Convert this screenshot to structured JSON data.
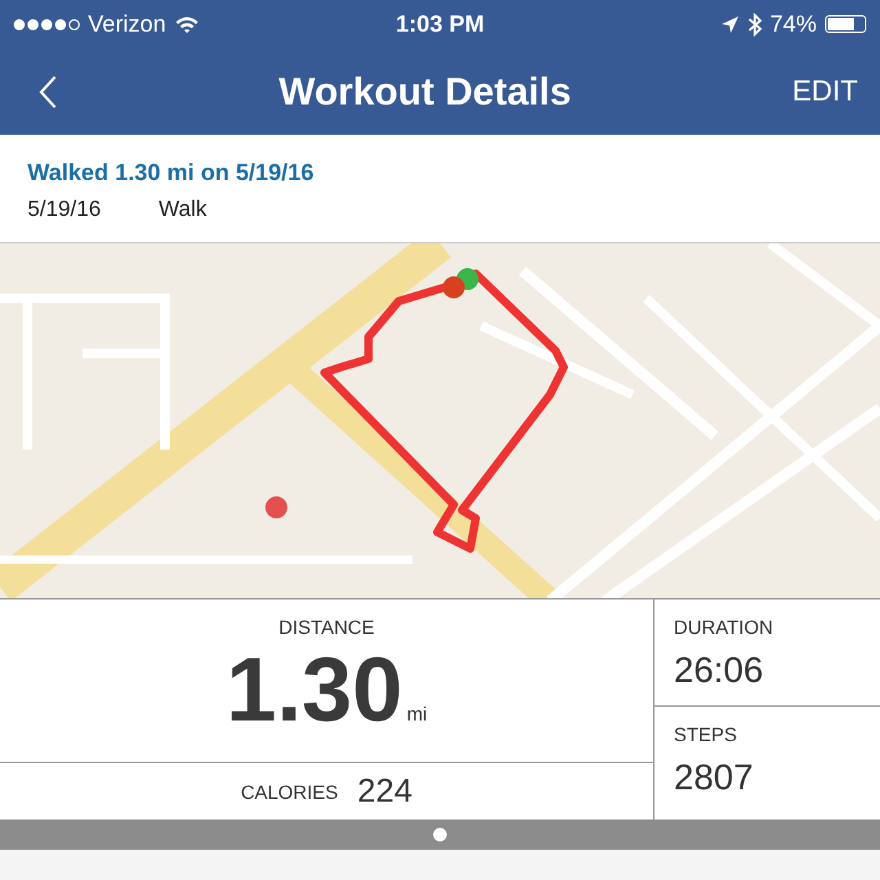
{
  "status_bar": {
    "signal_dots": [
      {
        "filled": true
      },
      {
        "filled": true
      },
      {
        "filled": true
      },
      {
        "filled": true
      },
      {
        "filled": false
      }
    ],
    "carrier": "Verizon",
    "time": "1:03 PM",
    "battery_text": "74%",
    "battery": {
      "level": 0.74
    }
  },
  "nav": {
    "title": "Workout Details",
    "action": "EDIT"
  },
  "summary": {
    "headline": "Walked 1.30 mi on 5/19/16",
    "date": "5/19/16",
    "type": "Walk"
  },
  "stats": {
    "distance": {
      "label": "DISTANCE",
      "value": "1.30",
      "unit": "mi"
    },
    "calories": {
      "label": "CALORIES",
      "value": "224"
    },
    "duration": {
      "label": "DURATION",
      "value": "26:06"
    },
    "steps": {
      "label": "STEPS",
      "value": "2807"
    }
  },
  "pager": [
    {
      "selected": true
    }
  ]
}
